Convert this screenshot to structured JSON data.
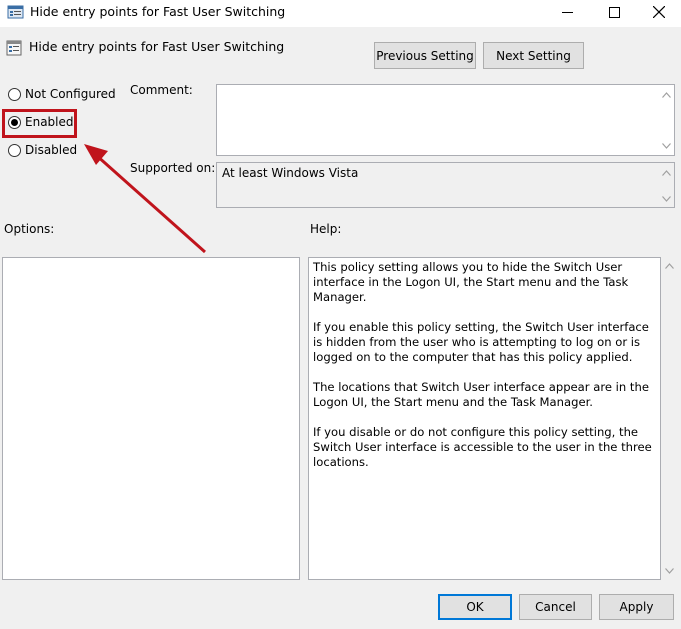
{
  "window": {
    "title": "Hide entry points for Fast User Switching"
  },
  "header": {
    "title": "Hide entry points for Fast User Switching",
    "previous_label": "Previous Setting",
    "next_label": "Next Setting"
  },
  "state": {
    "options": [
      {
        "label": "Not Configured",
        "selected": false
      },
      {
        "label": "Enabled",
        "selected": true
      },
      {
        "label": "Disabled",
        "selected": false
      }
    ]
  },
  "comment": {
    "label": "Comment:",
    "value": ""
  },
  "supported": {
    "label": "Supported on:",
    "value": "At least Windows Vista"
  },
  "options_label": "Options:",
  "help": {
    "label": "Help:",
    "paragraphs": [
      "This policy setting allows you to hide the Switch User interface in the Logon UI, the Start menu and the Task Manager.",
      "If you enable this policy setting, the Switch User interface is hidden from the user who is attempting to log on or is logged on to the computer that has this policy applied.",
      "The locations that Switch User interface appear are in the Logon UI, the Start menu and the Task Manager.",
      "If you disable or do not configure this policy setting, the Switch User interface is accessible to the user in the three locations."
    ]
  },
  "footer": {
    "ok_label": "OK",
    "cancel_label": "Cancel",
    "apply_label": "Apply"
  },
  "colors": {
    "annotation": "#c0141c",
    "focus": "#0078d7"
  },
  "icons": [
    "policy-window-icon",
    "minimize-icon",
    "maximize-icon",
    "close-icon",
    "policy-setting-icon",
    "scroll-up-icon",
    "scroll-down-icon",
    "annotation-arrow-icon"
  ]
}
